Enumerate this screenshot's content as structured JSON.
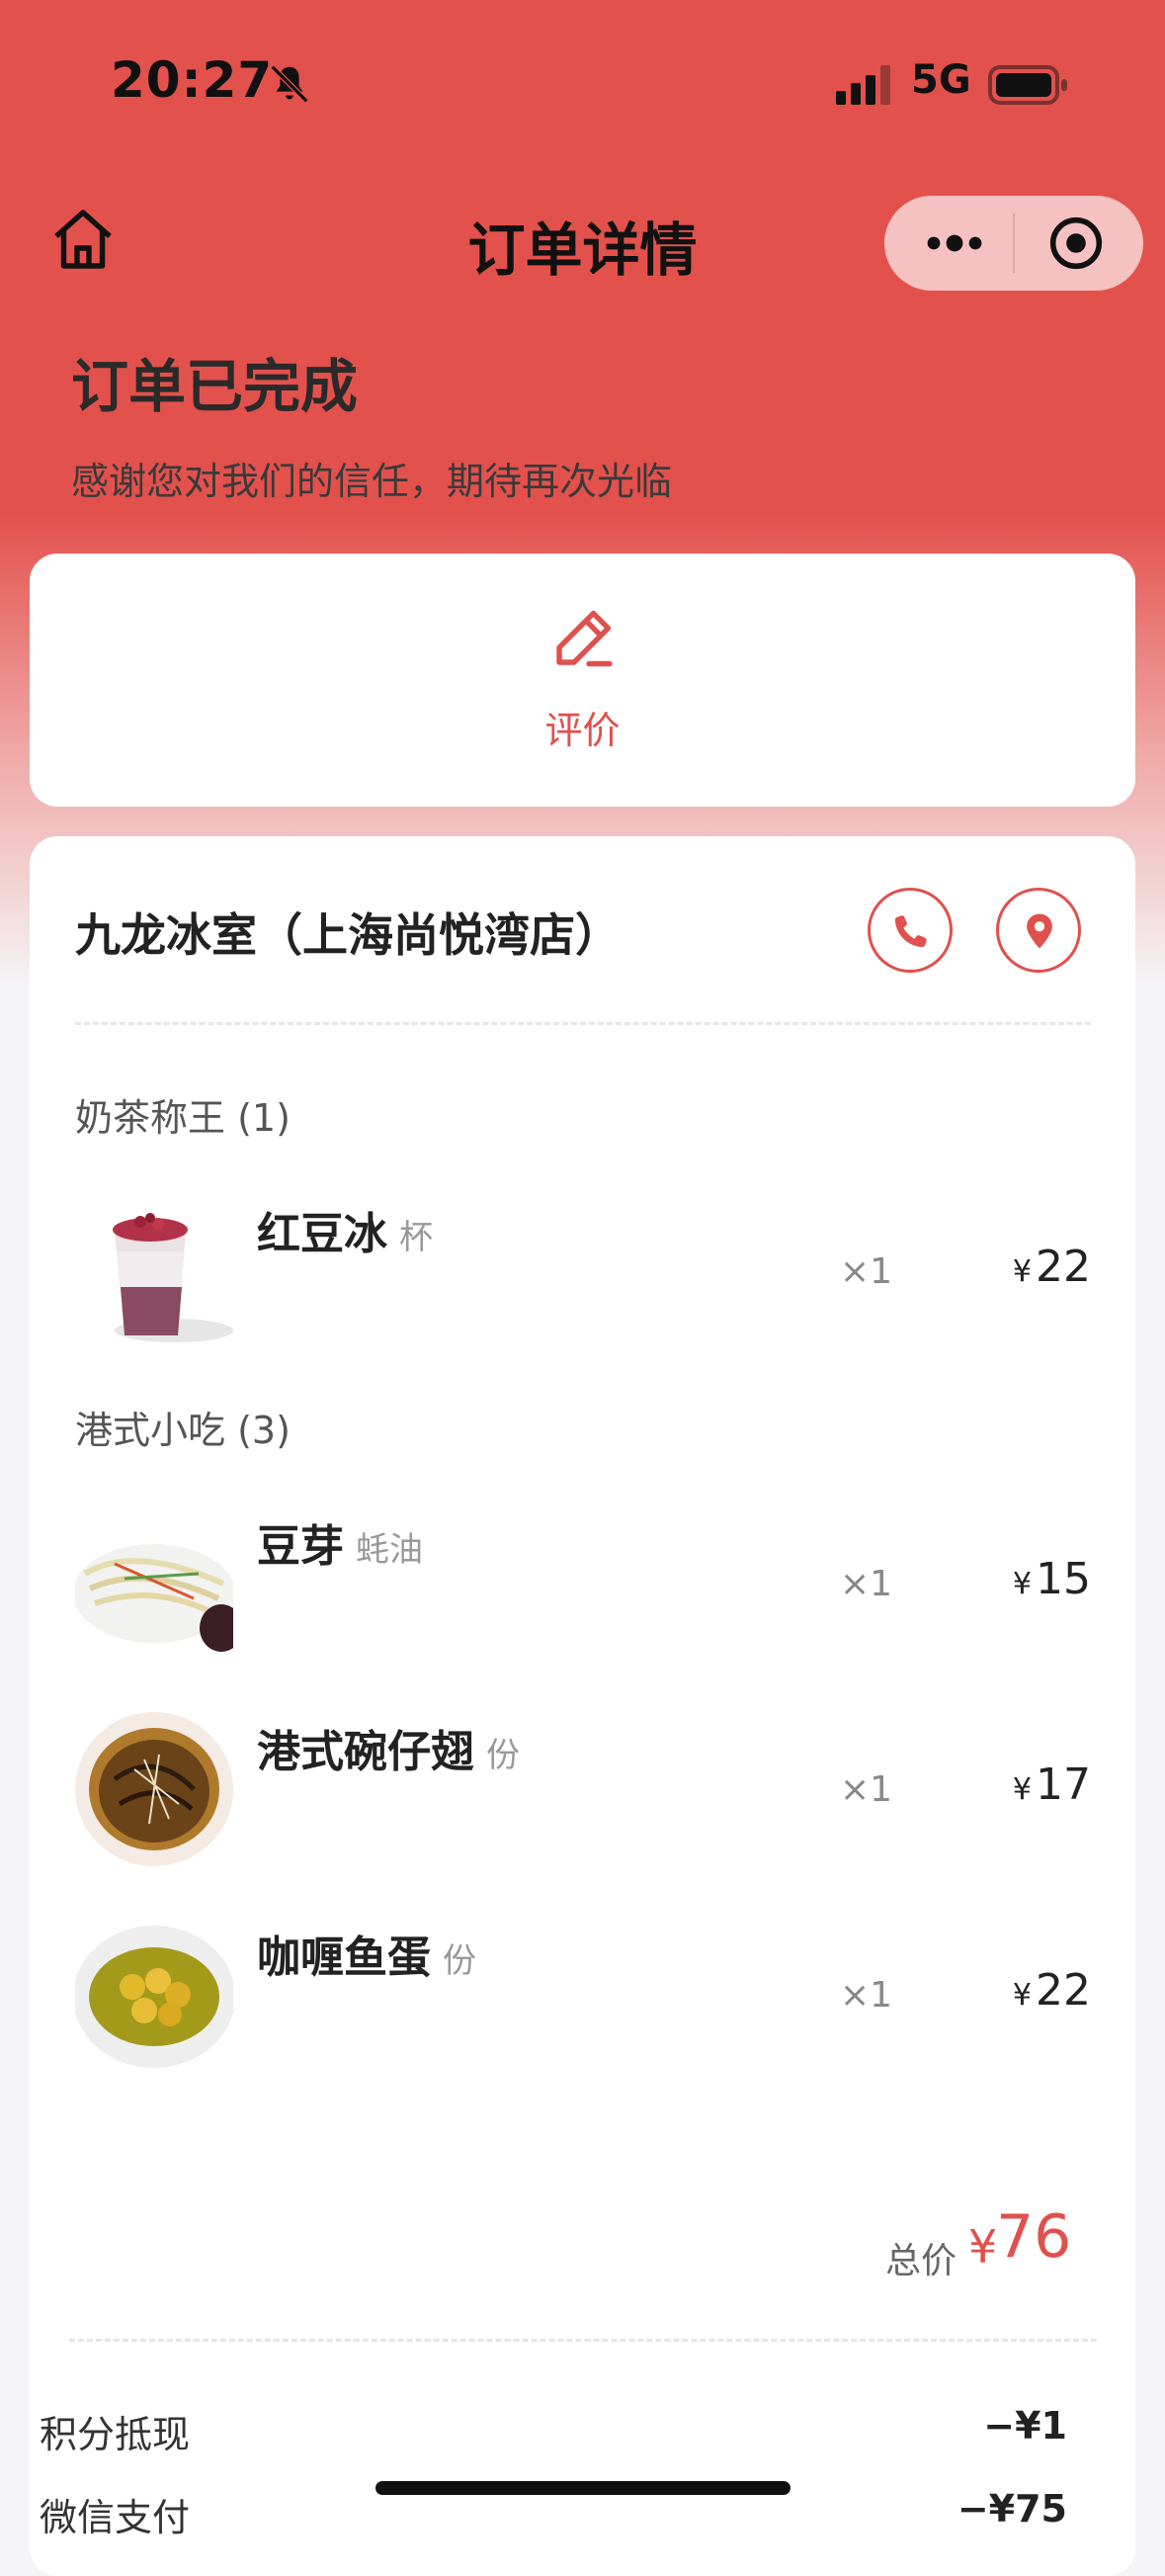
{
  "status_bar": {
    "time": "20:27",
    "network": "5G"
  },
  "nav": {
    "title": "订单详情"
  },
  "order": {
    "status": "订单已完成",
    "subtitle": "感谢您对我们的信任，期待再次光临"
  },
  "review": {
    "label": "评价"
  },
  "store": {
    "name": "九龙冰室（上海尚悦湾店）"
  },
  "categories": [
    {
      "title": "奶茶称王 (1)",
      "items": [
        {
          "name": "红豆冰",
          "unit": "杯",
          "qty": "×1",
          "yen": "¥",
          "price": "22"
        }
      ]
    },
    {
      "title": "港式小吃 (3)",
      "items": [
        {
          "name": "豆芽",
          "unit": "蚝油",
          "qty": "×1",
          "yen": "¥",
          "price": "15"
        },
        {
          "name": "港式碗仔翅",
          "unit": "份",
          "qty": "×1",
          "yen": "¥",
          "price": "17"
        },
        {
          "name": "咖喱鱼蛋",
          "unit": "份",
          "qty": "×1",
          "yen": "¥",
          "price": "22"
        }
      ]
    }
  ],
  "total": {
    "label": "总价",
    "yen": "¥",
    "value": "76"
  },
  "fees": [
    {
      "label": "积分抵现",
      "value": "−¥1"
    },
    {
      "label": "微信支付",
      "value": "−¥75"
    }
  ],
  "colors": {
    "accent": "#e3514d",
    "price_red": "#e0504c"
  },
  "icons": [
    "bell-slash-icon",
    "signal-icon",
    "battery-icon",
    "home-icon",
    "more-icon",
    "target-icon",
    "edit-icon",
    "phone-icon",
    "location-icon"
  ]
}
